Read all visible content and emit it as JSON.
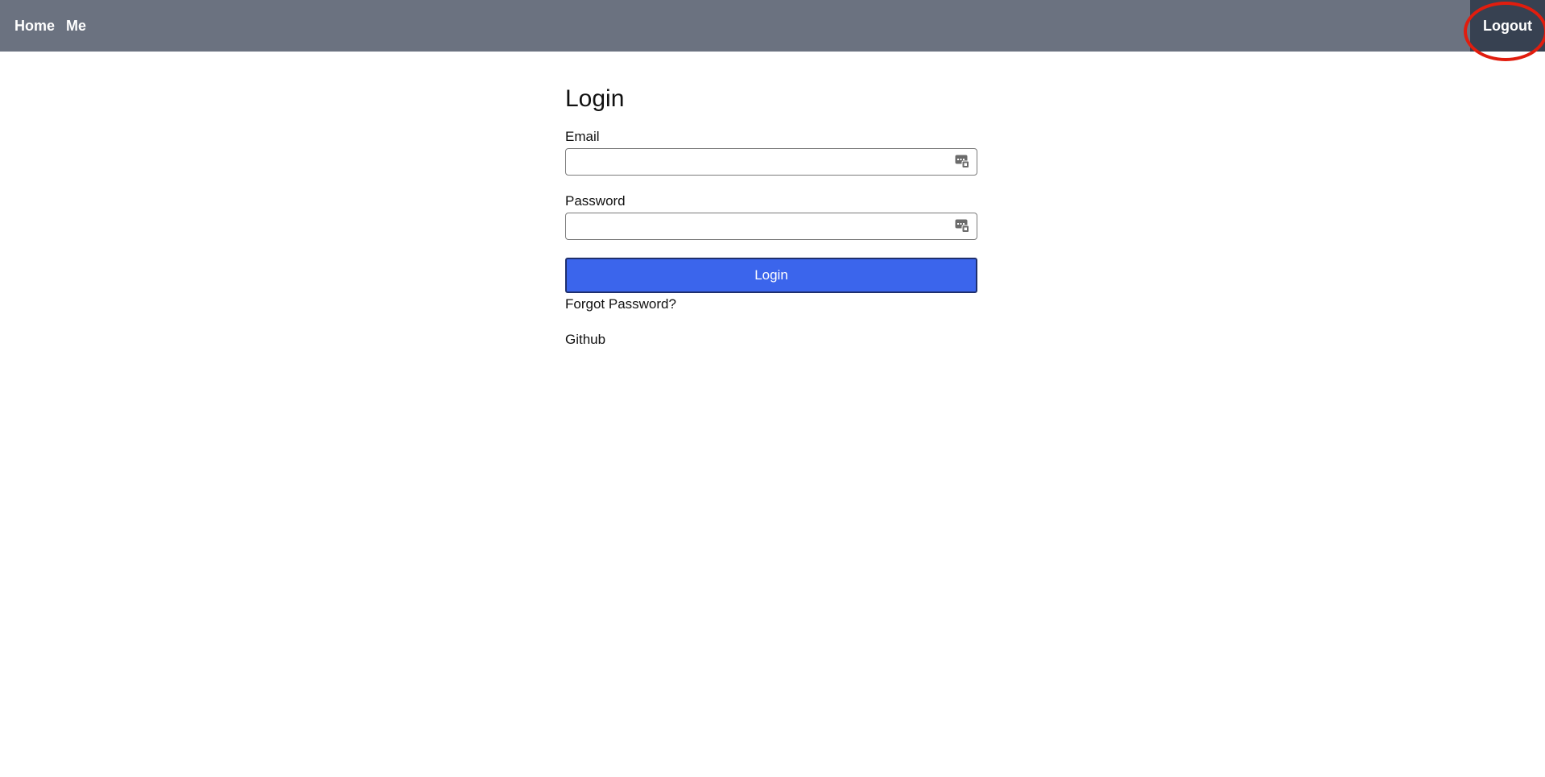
{
  "nav": {
    "home_label": "Home",
    "me_label": "Me",
    "logout_label": "Logout"
  },
  "login_form": {
    "title": "Login",
    "email_label": "Email",
    "email_value": "",
    "password_label": "Password",
    "password_value": "",
    "submit_label": "Login",
    "forgot_label": "Forgot Password?",
    "github_label": "Github",
    "autofill_icon": "password-manager-autofill-icon"
  },
  "colors": {
    "navbar_bg": "#6b7280",
    "logout_bg": "#374151",
    "primary_button": "#3b65ec",
    "highlight_ring": "#e11d0e"
  }
}
